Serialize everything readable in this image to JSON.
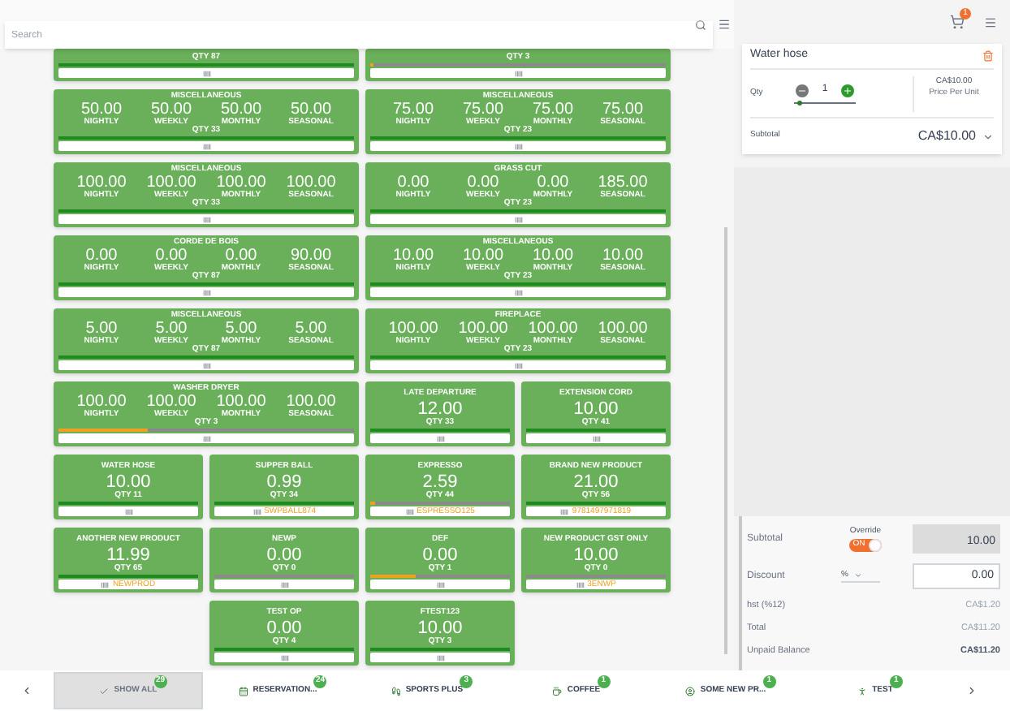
{
  "search": {
    "placeholder": "Search"
  },
  "products": [
    {
      "kind": "wide",
      "qty": "QTY 87",
      "level": 1
    },
    {
      "kind": "wide",
      "qty": "QTY 3",
      "level": 0.01
    },
    {
      "kind": "wide",
      "title": "MISCELLANEOUS",
      "prices": [
        {
          "value": "50.00",
          "period": "NIGHTLY"
        },
        {
          "value": "50.00",
          "period": "WEEKLY"
        },
        {
          "value": "50.00",
          "period": "MONTHLY"
        },
        {
          "value": "50.00",
          "period": "SEASONAL"
        }
      ],
      "qty": "QTY 33",
      "level": 1
    },
    {
      "kind": "wide",
      "title": "MISCELLANEOUS",
      "prices": [
        {
          "value": "75.00",
          "period": "NIGHTLY"
        },
        {
          "value": "75.00",
          "period": "WEEKLY"
        },
        {
          "value": "75.00",
          "period": "MONTHLY"
        },
        {
          "value": "75.00",
          "period": "SEASONAL"
        }
      ],
      "qty": "QTY 23",
      "level": 1
    },
    {
      "kind": "wide",
      "title": "MISCELLANEOUS",
      "prices": [
        {
          "value": "100.00",
          "period": "NIGHTLY"
        },
        {
          "value": "100.00",
          "period": "WEEKLY"
        },
        {
          "value": "100.00",
          "period": "MONTHLY"
        },
        {
          "value": "100.00",
          "period": "SEASONAL"
        }
      ],
      "qty": "QTY 33",
      "level": 1
    },
    {
      "kind": "wide",
      "title": "GRASS CUT",
      "prices": [
        {
          "value": "0.00",
          "period": "NIGHTLY"
        },
        {
          "value": "0.00",
          "period": "WEEKLY"
        },
        {
          "value": "0.00",
          "period": "MONTHLY"
        },
        {
          "value": "185.00",
          "period": "SEASONAL"
        }
      ],
      "qty": "QTY 23",
      "level": 1
    },
    {
      "kind": "wide",
      "title": "CORDE DE BOIS",
      "prices": [
        {
          "value": "0.00",
          "period": "NIGHTLY"
        },
        {
          "value": "0.00",
          "period": "WEEKLY"
        },
        {
          "value": "0.00",
          "period": "MONTHLY"
        },
        {
          "value": "90.00",
          "period": "SEASONAL"
        }
      ],
      "qty": "QTY 87",
      "level": 1
    },
    {
      "kind": "wide",
      "title": "MISCELLANEOUS",
      "prices": [
        {
          "value": "10.00",
          "period": "NIGHTLY"
        },
        {
          "value": "10.00",
          "period": "WEEKLY"
        },
        {
          "value": "10.00",
          "period": "MONTHLY"
        },
        {
          "value": "10.00",
          "period": "SEASONAL"
        }
      ],
      "qty": "QTY 23",
      "level": 1
    },
    {
      "kind": "wide",
      "title": "MISCELLANEOUS",
      "prices": [
        {
          "value": "5.00",
          "period": "NIGHTLY"
        },
        {
          "value": "5.00",
          "period": "WEEKLY"
        },
        {
          "value": "5.00",
          "period": "MONTHLY"
        },
        {
          "value": "5.00",
          "period": "SEASONAL"
        }
      ],
      "qty": "QTY 87",
      "level": 1
    },
    {
      "kind": "wide",
      "title": "FIREPLACE",
      "prices": [
        {
          "value": "100.00",
          "period": "NIGHTLY"
        },
        {
          "value": "100.00",
          "period": "WEEKLY"
        },
        {
          "value": "100.00",
          "period": "MONTHLY"
        },
        {
          "value": "100.00",
          "period": "SEASONAL"
        }
      ],
      "qty": "QTY 23",
      "level": 1
    },
    {
      "kind": "wide",
      "title": "WASHER DRYER",
      "prices": [
        {
          "value": "100.00",
          "period": "NIGHTLY"
        },
        {
          "value": "100.00",
          "period": "WEEKLY"
        },
        {
          "value": "100.00",
          "period": "MONTHLY"
        },
        {
          "value": "100.00",
          "period": "SEASONAL"
        }
      ],
      "qty": "QTY 3",
      "level": 0.3
    },
    {
      "kind": "small",
      "title": "LATE DEPARTURE",
      "price": "12.00",
      "qty": "QTY 33",
      "level": 1
    },
    {
      "kind": "small",
      "title": "EXTENSION CORD",
      "price": "10.00",
      "qty": "QTY 41",
      "level": 1
    },
    {
      "kind": "small",
      "title": "WATER HOSE",
      "price": "10.00",
      "qty": "QTY 11",
      "level": 1
    },
    {
      "kind": "small",
      "title": "SUPPER BALL",
      "price": "0.99",
      "qty": "QTY 34",
      "level": 1,
      "sku": "SWPBALL874"
    },
    {
      "kind": "small",
      "title": "EXPRESSO",
      "price": "2.59",
      "qty": "QTY 44",
      "level": 0.03,
      "sku": "ESPRESSO125"
    },
    {
      "kind": "small",
      "title": "BRAND NEW PRODUCT",
      "price": "21.00",
      "qty": "QTY 56",
      "level": 1,
      "sku": "9781497971819"
    },
    {
      "kind": "small",
      "title": "ANOTHER NEW PRODUCT",
      "price": "11.99",
      "qty": "QTY 65",
      "level": 1,
      "sku": "NEWPROD"
    },
    {
      "kind": "small",
      "title": "NEWP",
      "price": "0.00",
      "qty": "QTY 0",
      "level": 0
    },
    {
      "kind": "small",
      "title": "DEF",
      "price": "0.00",
      "qty": "QTY 1",
      "level": 0.33
    },
    {
      "kind": "small",
      "title": "NEW PRODUCT GST ONLY",
      "price": "10.00",
      "qty": "QTY 0",
      "level": 0,
      "sku": "3ENWP"
    },
    {
      "kind": "small",
      "title": "TEST OP",
      "price": "0.00",
      "qty": "QTY 4",
      "level": 1
    },
    {
      "kind": "small",
      "title": "FTEST123",
      "price": "10.00",
      "qty": "QTY 3",
      "level": 1
    }
  ],
  "cart": {
    "badge": "1",
    "item": {
      "name": "Water hose",
      "qty_label": "Qty",
      "qty": "1",
      "level": 0.05,
      "unit_price": "CA$10.00",
      "unit_label": "Price Per Unit",
      "subtotal_label": "Subtotal",
      "subtotal": "CA$10.00"
    }
  },
  "summary": {
    "subtotal_label": "Subtotal",
    "override_label": "Override",
    "override": true,
    "override_text": "ON",
    "subtotal": "10.00",
    "discount_label": "Discount",
    "discount_unit": "%",
    "discount": "0.00",
    "lines": [
      {
        "label": "hst (%12)",
        "value": "CA$1.20",
        "bold": false
      },
      {
        "label": "Total",
        "value": "CA$11.20",
        "bold": false
      },
      {
        "label": "Unpaid Balance",
        "value": "CA$11.20",
        "bold": true
      }
    ]
  },
  "categories": [
    {
      "kind": "check",
      "label": "SHOW ALL",
      "count": "29",
      "selected": true
    },
    {
      "kind": "calendar",
      "label": "RESERVATION...",
      "count": "24",
      "selected": false
    },
    {
      "kind": "runner",
      "label": "SPORTS PLUS",
      "count": "3",
      "selected": false
    },
    {
      "kind": "cup",
      "label": "COFFEE",
      "count": "1",
      "selected": false
    },
    {
      "kind": "circle",
      "label": "SOME NEW PR...",
      "count": "1",
      "selected": false
    },
    {
      "kind": "figure",
      "label": "TEST",
      "count": "1",
      "selected": false
    }
  ]
}
